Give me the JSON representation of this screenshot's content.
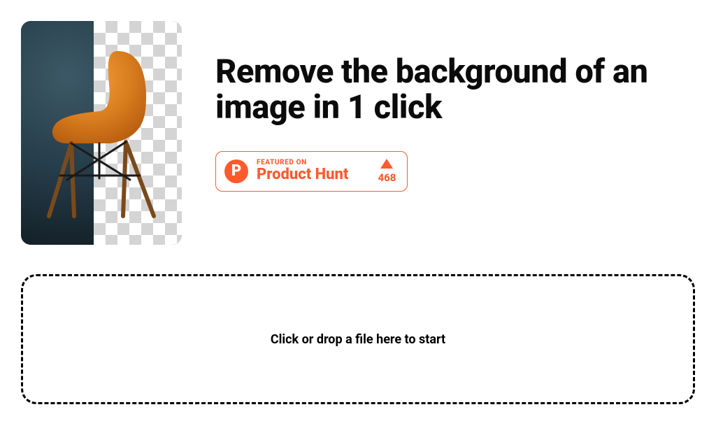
{
  "hero": {
    "headline": "Remove the background of an image in 1 click",
    "demo_alt": "chair-before-after"
  },
  "product_hunt": {
    "featured_label": "FEATURED ON",
    "name": "Product Hunt",
    "logo_letter": "P",
    "vote_count": "468"
  },
  "dropzone": {
    "prompt": "Click or drop a file here to start"
  },
  "colors": {
    "accent": "#ff5a2d"
  }
}
